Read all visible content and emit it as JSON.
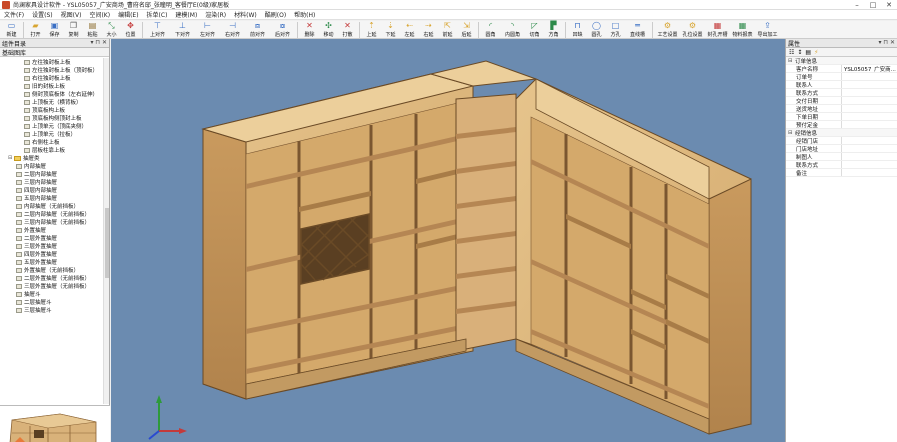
{
  "window": {
    "title": "尚澜家具设计软件 - YSL05057_广安商场_曹府名邸_张瞳明_客餐厅E(0级)家居板"
  },
  "menu": [
    "文件(F)",
    "设置(S)",
    "视图(V)",
    "空间(K)",
    "编辑(E)",
    "拆单(C)",
    "建模(M)",
    "渲染(R)",
    "材料(W)",
    "酷刷(O)",
    "帮助(H)"
  ],
  "toolbar": [
    {
      "label": "新建",
      "icon": "new-icon",
      "color": "#3a6fc4"
    },
    {
      "label": "打开",
      "icon": "open-icon",
      "color": "#d8a531"
    },
    {
      "label": "保存",
      "icon": "save-icon",
      "color": "#3a6fc4"
    },
    {
      "label": "复制",
      "icon": "copy-icon",
      "color": "#555555"
    },
    {
      "label": "粘贴",
      "icon": "paste-icon",
      "color": "#8a6a2a"
    },
    {
      "label": "大小",
      "icon": "resize-icon",
      "color": "#2d8a4a"
    },
    {
      "label": "位置",
      "icon": "position-icon",
      "color": "#c43a3a"
    },
    {
      "label": "上对齐",
      "icon": "align-top-icon",
      "color": "#3a6fc4"
    },
    {
      "label": "下对齐",
      "icon": "align-bottom-icon",
      "color": "#3a6fc4"
    },
    {
      "label": "左对齐",
      "icon": "align-left-icon",
      "color": "#3a6fc4"
    },
    {
      "label": "右对齐",
      "icon": "align-right-icon",
      "color": "#3a6fc4"
    },
    {
      "label": "前对齐",
      "icon": "align-front-icon",
      "color": "#3a6fc4"
    },
    {
      "label": "后对齐",
      "icon": "align-back-icon",
      "color": "#3a6fc4"
    },
    {
      "label": "删除",
      "icon": "delete-icon",
      "color": "#c43a3a"
    },
    {
      "label": "移动",
      "icon": "move-icon",
      "color": "#2d8a4a"
    },
    {
      "label": "打散",
      "icon": "explode-icon",
      "color": "#c43a3a"
    },
    {
      "label": "上延",
      "icon": "extend-up-icon",
      "color": "#d8a531"
    },
    {
      "label": "下延",
      "icon": "extend-down-icon",
      "color": "#d8a531"
    },
    {
      "label": "左延",
      "icon": "extend-left-icon",
      "color": "#d8a531"
    },
    {
      "label": "右延",
      "icon": "extend-right-icon",
      "color": "#d8a531"
    },
    {
      "label": "前延",
      "icon": "extend-front-icon",
      "color": "#d8a531"
    },
    {
      "label": "后延",
      "icon": "extend-back-icon",
      "color": "#d8a531"
    },
    {
      "label": "圆角",
      "icon": "round-corner-icon",
      "color": "#2d8a4a"
    },
    {
      "label": "内圆角",
      "icon": "inner-round-icon",
      "color": "#2d8a4a"
    },
    {
      "label": "切角",
      "icon": "chamfer-icon",
      "color": "#2d8a4a"
    },
    {
      "label": "方角",
      "icon": "square-corner-icon",
      "color": "#2d8a4a"
    },
    {
      "label": "凹缺",
      "icon": "notch-icon",
      "color": "#3a6fc4"
    },
    {
      "label": "圆孔",
      "icon": "round-hole-icon",
      "color": "#3a6fc4"
    },
    {
      "label": "方孔",
      "icon": "square-hole-icon",
      "color": "#3a6fc4"
    },
    {
      "label": "直线槽",
      "icon": "line-groove-icon",
      "color": "#3a6fc4"
    },
    {
      "label": "工艺设置",
      "icon": "process-settings-icon",
      "color": "#d8a531"
    },
    {
      "label": "孔位设置",
      "icon": "hole-settings-icon",
      "color": "#d8a531"
    },
    {
      "label": "封孔开槽",
      "icon": "seal-groove-icon",
      "color": "#c43a3a"
    },
    {
      "label": "物料报表",
      "icon": "material-report-icon",
      "color": "#2d8a4a"
    },
    {
      "label": "导出加工",
      "icon": "export-machining-icon",
      "color": "#3a6fc4"
    }
  ],
  "left_panel": {
    "title": "组件目录",
    "subtitle": "基础图库",
    "items": [
      {
        "label": "左往独封板上板",
        "type": "file",
        "indent": 3
      },
      {
        "label": "左往独封板上板（顶封板）",
        "type": "file",
        "indent": 3
      },
      {
        "label": "右往独封板上板",
        "type": "file",
        "indent": 3
      },
      {
        "label": "旧的封板上板",
        "type": "file",
        "indent": 3
      },
      {
        "label": "侧封顶底板体（左右延伸）",
        "type": "file",
        "indent": 3
      },
      {
        "label": "上顶板无（横背板）",
        "type": "file",
        "indent": 3
      },
      {
        "label": "顶底板构上板",
        "type": "file",
        "indent": 3
      },
      {
        "label": "顶底板构侧顶封上板",
        "type": "file",
        "indent": 3
      },
      {
        "label": "上顶单元（顶底夹侧）",
        "type": "file",
        "indent": 3
      },
      {
        "label": "上顶单元（拉板）",
        "type": "file",
        "indent": 3
      },
      {
        "label": "右侧柱上板",
        "type": "file",
        "indent": 3
      },
      {
        "label": "层板柱靠上板",
        "type": "file",
        "indent": 3
      },
      {
        "label": "抽屉类",
        "type": "folder",
        "indent": 1
      },
      {
        "label": "内部抽屉",
        "type": "file",
        "indent": 2
      },
      {
        "label": "二层内部抽屉",
        "type": "file",
        "indent": 2
      },
      {
        "label": "三层内部抽屉",
        "type": "file",
        "indent": 2
      },
      {
        "label": "四层内部抽屉",
        "type": "file",
        "indent": 2
      },
      {
        "label": "五层内部抽屉",
        "type": "file",
        "indent": 2
      },
      {
        "label": "内部抽屉（无前挡板）",
        "type": "file",
        "indent": 2
      },
      {
        "label": "二层内部抽屉（无前挡板）",
        "type": "file",
        "indent": 2
      },
      {
        "label": "三层内部抽屉（无前挡板）",
        "type": "file",
        "indent": 2
      },
      {
        "label": "外置抽屉",
        "type": "file",
        "indent": 2
      },
      {
        "label": "二层外置抽屉",
        "type": "file",
        "indent": 2
      },
      {
        "label": "三层外置抽屉",
        "type": "file",
        "indent": 2
      },
      {
        "label": "四层外置抽屉",
        "type": "file",
        "indent": 2
      },
      {
        "label": "五层外置抽屉",
        "type": "file",
        "indent": 2
      },
      {
        "label": "外置抽屉（无前挡板）",
        "type": "file",
        "indent": 2
      },
      {
        "label": "二层外置抽屉（无前挡板）",
        "type": "file",
        "indent": 2
      },
      {
        "label": "三层外置抽屉（无前挡板）",
        "type": "file",
        "indent": 2
      },
      {
        "label": "抽屉斗",
        "type": "file",
        "indent": 2
      },
      {
        "label": "二层抽屉斗",
        "type": "file",
        "indent": 2
      },
      {
        "label": "三层抽屉斗",
        "type": "file",
        "indent": 2
      }
    ]
  },
  "right_panel": {
    "title": "属性",
    "groups": [
      {
        "name": "订单信息",
        "rows": [
          {
            "key": "客户名称",
            "value": "YSL05057_广安商..."
          },
          {
            "key": "订单号",
            "value": ""
          },
          {
            "key": "联系人",
            "value": ""
          },
          {
            "key": "联系方式",
            "value": ""
          },
          {
            "key": "交付日期",
            "value": ""
          },
          {
            "key": "送货地址",
            "value": ""
          },
          {
            "key": "下单日期",
            "value": ""
          },
          {
            "key": "预付定金",
            "value": ""
          }
        ]
      },
      {
        "name": "经销信息",
        "rows": [
          {
            "key": "经销门店",
            "value": ""
          },
          {
            "key": "门店地址",
            "value": ""
          },
          {
            "key": "制图人",
            "value": ""
          },
          {
            "key": "联系方式",
            "value": ""
          },
          {
            "key": "备注",
            "value": ""
          }
        ]
      }
    ]
  },
  "colors": {
    "viewport_bg": "#6b8bb0",
    "wood_light": "#e0bd82",
    "wood_mid": "#cfa46a",
    "wood_dark": "#a87c47",
    "edge": "#6a4a26"
  }
}
